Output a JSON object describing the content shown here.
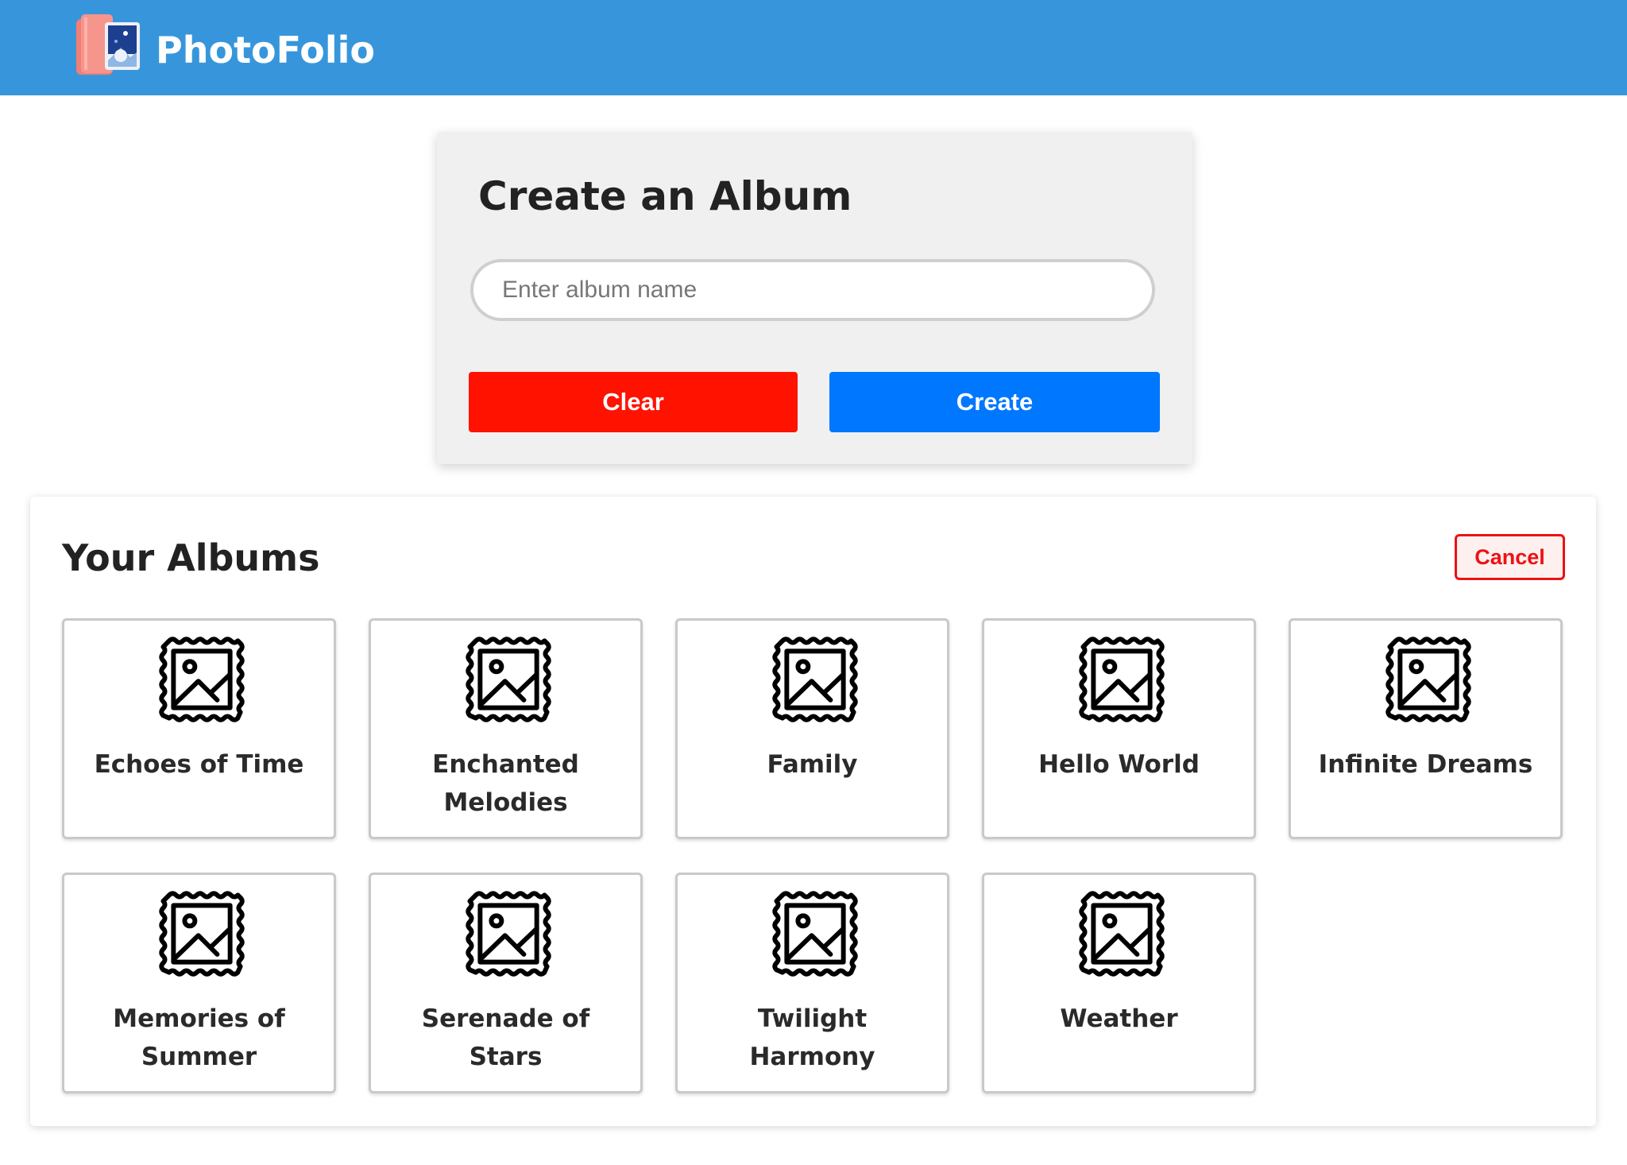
{
  "header": {
    "brand": "PhotoFolio",
    "background": "#3796db"
  },
  "create_album": {
    "title": "Create an Album",
    "input_placeholder": "Enter album name",
    "input_value": "",
    "clear_label": "Clear",
    "create_label": "Create"
  },
  "albums": {
    "title": "Your Albums",
    "cancel_label": "Cancel",
    "items": [
      {
        "name": "Echoes of Time",
        "icon": "framed-image-icon"
      },
      {
        "name": "Enchanted Melodies",
        "icon": "framed-image-icon"
      },
      {
        "name": "Family",
        "icon": "framed-image-icon"
      },
      {
        "name": "Hello World",
        "icon": "framed-image-icon"
      },
      {
        "name": "Infinite Dreams",
        "icon": "framed-image-icon"
      },
      {
        "name": "Memories of Summer",
        "icon": "framed-image-icon"
      },
      {
        "name": "Serenade of Stars",
        "icon": "framed-image-icon"
      },
      {
        "name": "Twilight Harmony",
        "icon": "framed-image-icon"
      },
      {
        "name": "Weather",
        "icon": "framed-image-icon"
      }
    ]
  },
  "colors": {
    "clear": "#ff1200",
    "create": "#0077ff",
    "cancel": "#ee1111"
  }
}
